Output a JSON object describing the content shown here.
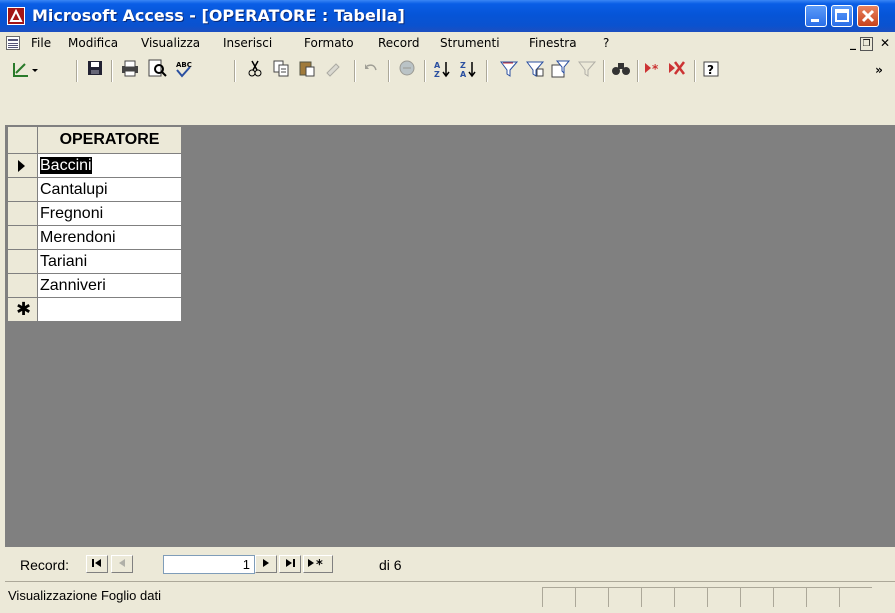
{
  "window": {
    "title": "Microsoft Access - [OPERATORE : Tabella]"
  },
  "menu": {
    "items": [
      "File",
      "Modifica",
      "Visualizza",
      "Inserisci",
      "Formato",
      "Record",
      "Strumenti",
      "Finestra",
      "?"
    ]
  },
  "datasheet": {
    "column_header": "OPERATORE",
    "rows": [
      "Baccini",
      "Cantalupi",
      "Fregnoni",
      "Merendoni",
      "Tariani",
      "Zanniveri"
    ],
    "current_row_index": 0
  },
  "navigation": {
    "label": "Record:",
    "current": "1",
    "total_text": "di 6"
  },
  "status": {
    "text": "Visualizzazione Foglio dati"
  },
  "icons": {
    "toolbar": [
      "view-icon",
      "save-icon",
      "print-icon",
      "print-preview-icon",
      "spelling-icon",
      "cut-icon",
      "copy-icon",
      "paste-icon",
      "format-painter-icon",
      "undo-icon",
      "hyperlink-icon",
      "sort-ascending-icon",
      "sort-descending-icon",
      "filter-by-selection-icon",
      "filter-by-form-icon",
      "advanced-filter-icon",
      "apply-filter-icon",
      "find-icon",
      "new-record-icon",
      "delete-record-icon",
      "help-icon"
    ]
  }
}
